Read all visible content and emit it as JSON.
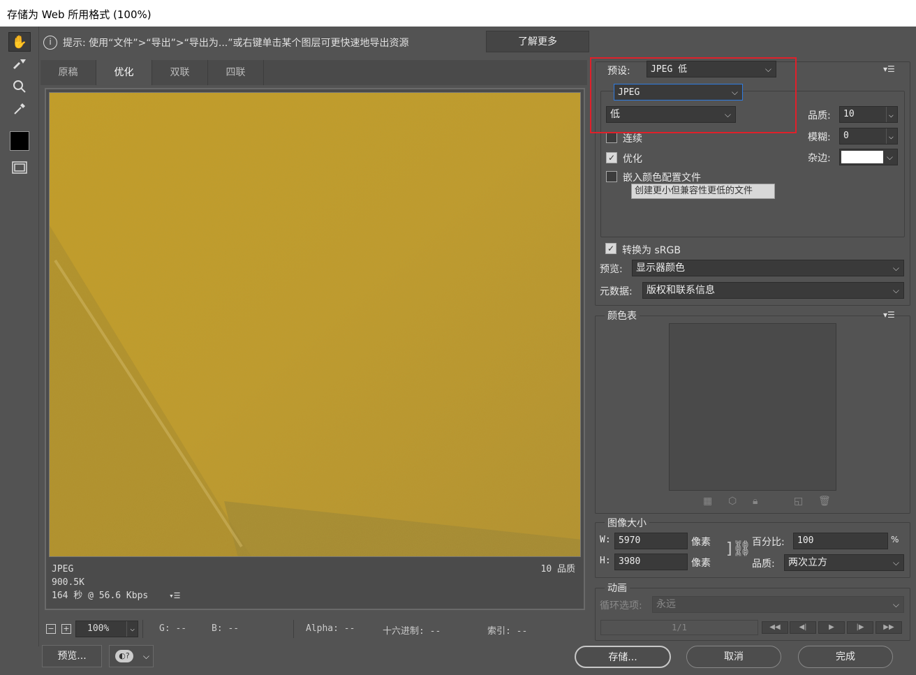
{
  "window": {
    "title": "存储为 Web 所用格式 (100%)"
  },
  "hint": {
    "text": "提示: 使用“文件”>“导出”>“导出为...”或右键单击某个图层可更快速地导出资源",
    "learn_more": "了解更多"
  },
  "tabs": [
    "原稿",
    "优化",
    "双联",
    "四联"
  ],
  "active_tab": "优化",
  "image_info": {
    "format": "JPEG",
    "size": "900.5K",
    "time": "164 秒 @ 56.6 Kbps",
    "quality": "10 品质"
  },
  "status": {
    "zoom": "100%",
    "g": "G: --",
    "b": "B: --",
    "alpha": "Alpha: --",
    "hex": "十六进制: --",
    "index": "索引: --"
  },
  "buttons": {
    "preview": "预览...",
    "save": "存储...",
    "cancel": "取消",
    "done": "完成"
  },
  "settings": {
    "preset_label": "预设:",
    "preset_value": "JPEG 低",
    "format_value": "JPEG",
    "quality_preset_value": "低",
    "quality_label": "品质:",
    "quality_value": "10",
    "blur_label": "模糊:",
    "blur_value": "0",
    "matte_label": "杂边:",
    "matte_color": "#ffffff",
    "progressive_label": "连续",
    "progressive_checked": false,
    "optimized_label": "优化",
    "optimized_checked": true,
    "embed_profile_label": "嵌入颜色配置文件",
    "embed_profile_checked": false,
    "tooltip": "创建更小但兼容性更低的文件",
    "convert_srgb_label": "转换为 sRGB",
    "convert_srgb_checked": true,
    "preview_label": "预览:",
    "preview_value": "显示器颜色",
    "metadata_label": "元数据:",
    "metadata_value": "版权和联系信息"
  },
  "color_table": {
    "title": "颜色表"
  },
  "image_size": {
    "title": "图像大小",
    "w_label": "W:",
    "w_value": "5970",
    "w_unit": "像素",
    "h_label": "H:",
    "h_value": "3980",
    "h_unit": "像素",
    "percent_label": "百分比:",
    "percent_value": "100",
    "percent_unit": "%",
    "quality_label": "品质:",
    "quality_value": "两次立方"
  },
  "animation": {
    "title": "动画",
    "loop_label": "循环选项:",
    "loop_value": "永远",
    "frame_counter": "1/1"
  },
  "colors": {
    "highlight_box": "#e0202a",
    "focus_border": "#2f7be0",
    "image_base": "#c09a2a"
  }
}
